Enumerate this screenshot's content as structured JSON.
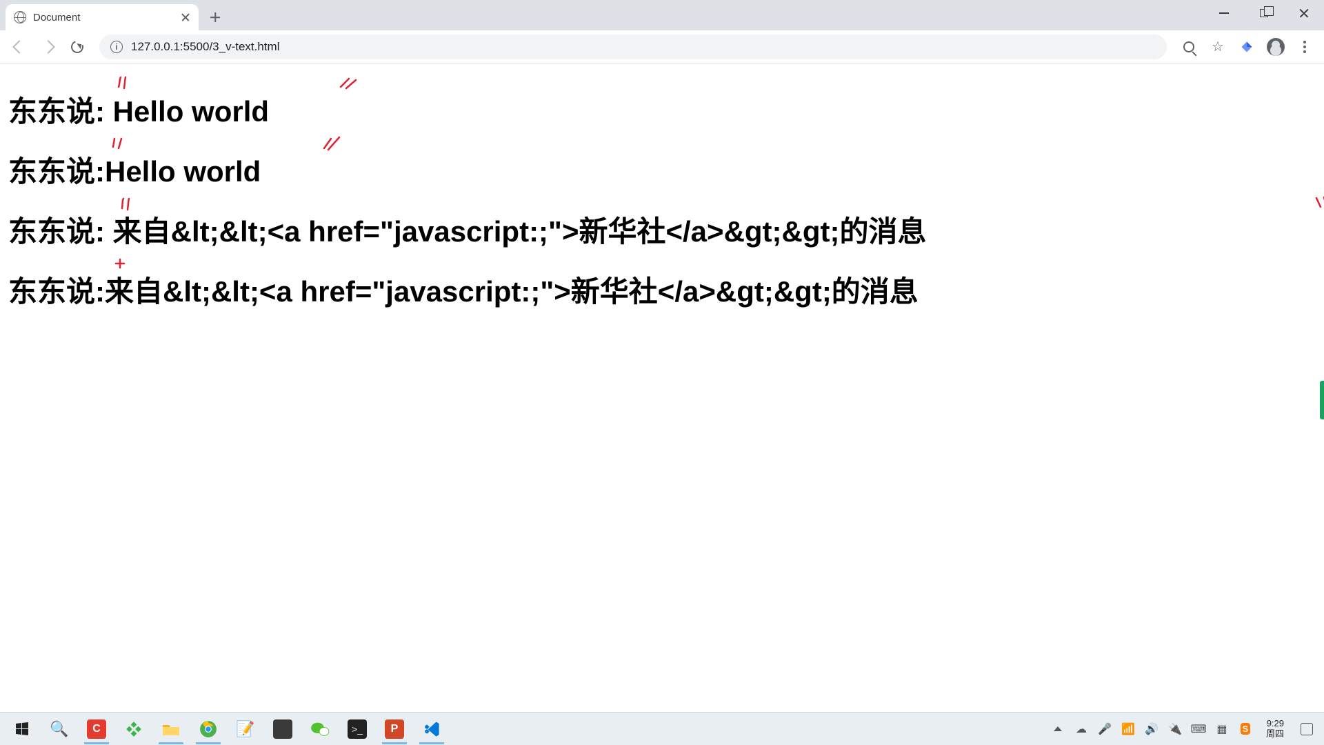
{
  "browser": {
    "tab_title": "Document",
    "url": "127.0.0.1:5500/3_v-text.html"
  },
  "page": {
    "line1_prefix": "东东说:",
    "line1_rest": " Hello world",
    "line2": "东东说:Hello world",
    "line3_prefix": "东东说:",
    "line3_rest": " 来自&lt;&lt;<a href=\"javascript:;\">新华社</a>&gt;&gt;的消息",
    "line4": "东东说:来自&lt;&lt;<a href=\"javascript:;\">新华社</a>&gt;&gt;的消息"
  },
  "system": {
    "time": "9:29",
    "day": "周四"
  }
}
